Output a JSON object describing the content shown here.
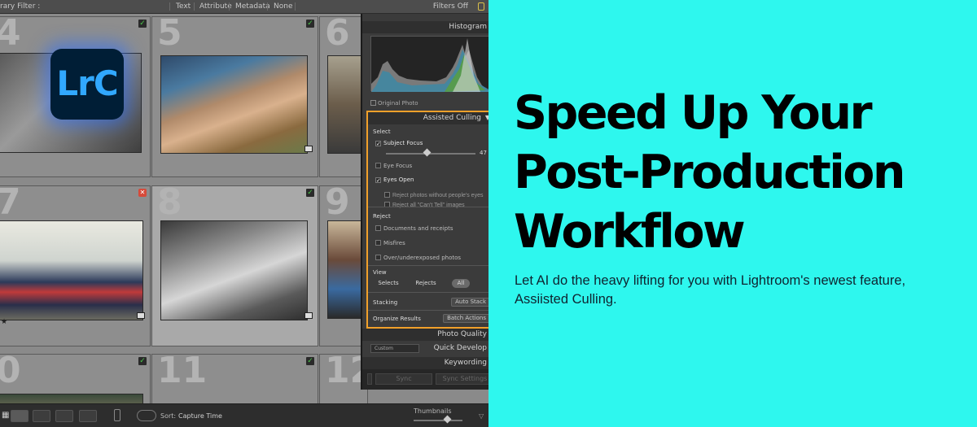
{
  "filter_bar": {
    "label": "rary Filter :",
    "options": [
      "Text",
      "Attribute",
      "Metadata",
      "None"
    ],
    "status": "Filters Off"
  },
  "grid": {
    "cells": [
      {
        "number": "4",
        "status": "picked"
      },
      {
        "number": "5",
        "status": "picked"
      },
      {
        "number": "6",
        "status": "picked"
      },
      {
        "number": "7",
        "status": "rejected"
      },
      {
        "number": "8",
        "status": "picked"
      },
      {
        "number": "9",
        "status": "none"
      },
      {
        "number": "0",
        "status": "picked"
      },
      {
        "number": "11",
        "status": "picked"
      },
      {
        "number": "12",
        "status": "none"
      }
    ],
    "star_label": "★"
  },
  "logo": {
    "text": "LrC",
    "color": "#31a8ff",
    "background": "#001e36"
  },
  "panel": {
    "histogram": {
      "title": "Histogram",
      "original_photo": "Original Photo"
    },
    "assisted_culling": {
      "title": "Assisted Culling",
      "select_label": "Select",
      "subject_focus": "Subject Focus",
      "subject_focus_value": "47",
      "eye_focus": "Eye Focus",
      "eyes_open": "Eyes Open",
      "reject_no_people": "Reject photos without people's eyes",
      "reject_cant_tell": "Reject all \"Can't Tell\" images",
      "reject_label": "Reject",
      "documents": "Documents and receipts",
      "misfires": "Misfires",
      "over_under": "Over/underexposed photos",
      "view_label": "View",
      "view_selects": "Selects",
      "view_rejects": "Rejects",
      "view_all": "All",
      "stacking_label": "Stacking",
      "auto_stack": "Auto Stack",
      "organize_label": "Organize Results",
      "batch_actions": "Batch Actions"
    },
    "photo_quality": "Photo Quality",
    "quick_develop": "Quick Develop",
    "custom": "Custom",
    "keywording": "Keywording",
    "sync": "Sync",
    "sync_settings": "Sync Settings"
  },
  "toolbar": {
    "sort_label": "Sort:",
    "sort_value": "Capture Time",
    "thumbnails_label": "Thumbnails"
  },
  "headline": {
    "line1": "Speed Up Your",
    "line2": "Post-Production",
    "line3": "Workflow"
  },
  "subtitle": "Let AI do the heavy lifting for you with Lightroom's newest feature, Assiisted Culling.",
  "colors": {
    "background": "#2ef7ee",
    "accent": "#f1a02a"
  }
}
